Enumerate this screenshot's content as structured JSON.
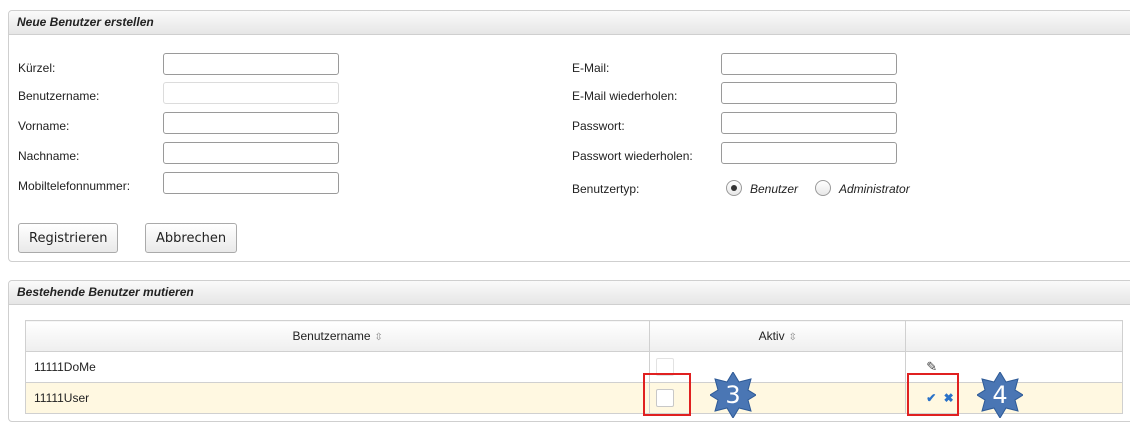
{
  "create_panel": {
    "title": "Neue Benutzer erstellen",
    "left_fields": [
      {
        "label": "Kürzel:",
        "value": ""
      },
      {
        "label": "Benutzername:",
        "value": ""
      },
      {
        "label": "Vorname:",
        "value": ""
      },
      {
        "label": "Nachname:",
        "value": ""
      },
      {
        "label": "Mobiltelefonnummer:",
        "value": ""
      }
    ],
    "right_fields": [
      {
        "label": "E-Mail:",
        "value": ""
      },
      {
        "label": "E-Mail wiederholen:",
        "value": ""
      },
      {
        "label": "Passwort:",
        "value": ""
      },
      {
        "label": "Passwort wiederholen:",
        "value": ""
      }
    ],
    "usertype": {
      "label": "Benutzertyp:",
      "options": [
        "Benutzer",
        "Administrator"
      ],
      "selected": "Benutzer"
    },
    "buttons": {
      "register": "Registrieren",
      "cancel": "Abbrechen"
    }
  },
  "list_panel": {
    "title": "Bestehende Benutzer mutieren",
    "columns": [
      "Benutzername",
      "Aktiv",
      ""
    ],
    "rows": [
      {
        "username": "11111DoMe",
        "active": false
      },
      {
        "username": "11111User",
        "active": false
      }
    ]
  },
  "annotations": {
    "badge_3": "3",
    "badge_4": "4",
    "highlight_color": "#e02020",
    "badge_color": "#4a76b4"
  },
  "icons": {
    "sort": "sort-icon",
    "edit": "pencil-icon",
    "confirm": "checkmark-icon",
    "cancel": "cross-icon"
  }
}
